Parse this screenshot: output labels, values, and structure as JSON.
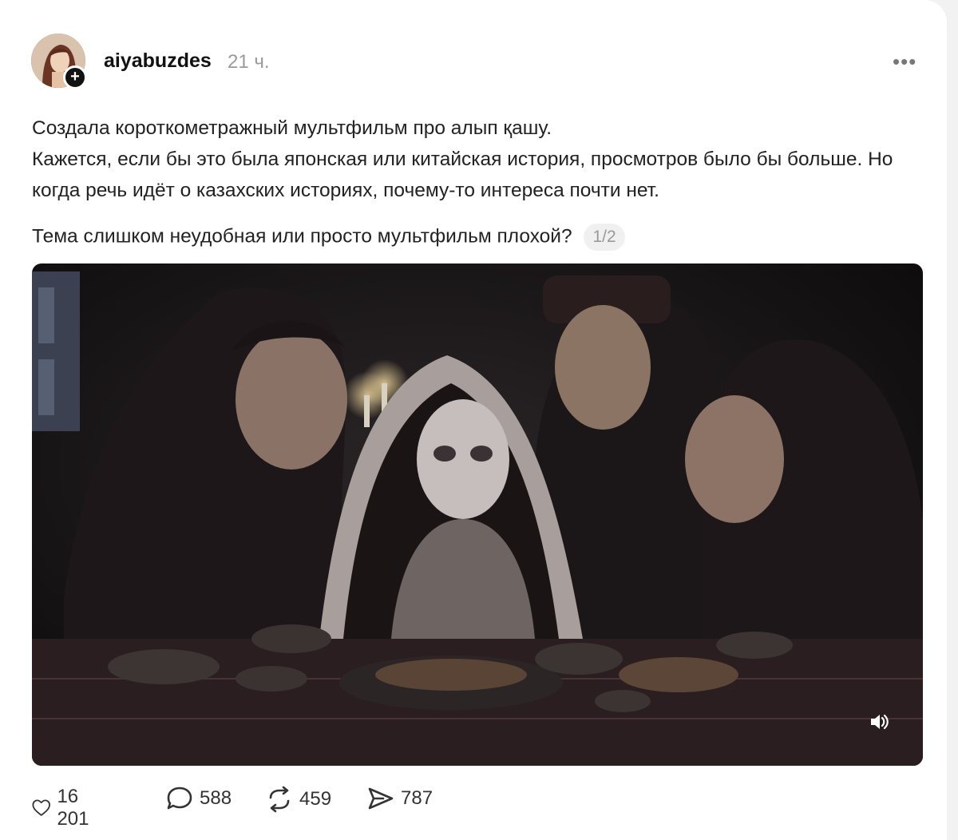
{
  "post": {
    "username": "aiyabuzdes",
    "time": "21 ч.",
    "more": "•••",
    "follow_symbol": "+",
    "paragraph1_line1": "Создала короткометражный мультфильм про алып қашу.",
    "paragraph1_line2": "Кажется, если бы это была японская или китайская история, просмотров было бы больше. Но когда речь идёт о казахских историях, почему-то интереса почти нет.",
    "question": "Тема слишком неудобная или просто мультфильм плохой?",
    "pager": "1/2"
  },
  "actions": {
    "likes": "16 201",
    "comments": "588",
    "reposts": "459",
    "shares": "787"
  },
  "icons": {
    "avatar": "avatar-portrait",
    "follow": "plus-icon",
    "more": "more-dots-icon",
    "sound": "speaker-icon",
    "like": "heart-icon",
    "comment": "comment-bubble-icon",
    "repost": "repost-arrows-icon",
    "share": "send-arrow-icon"
  },
  "colors": {
    "text": "#222222",
    "muted": "#9a9a9a",
    "background": "#ffffff"
  }
}
